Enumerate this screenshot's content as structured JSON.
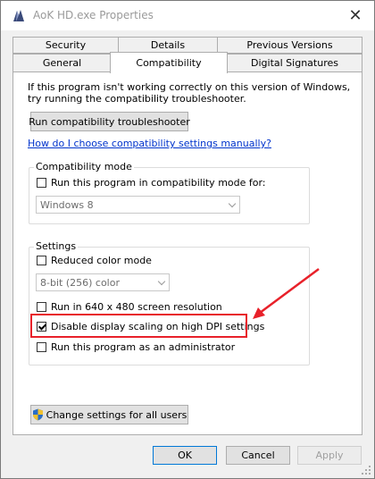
{
  "window": {
    "title": "AoK HD.exe Properties",
    "close_symbol": "✕"
  },
  "tabs": {
    "row1": [
      "Security",
      "Details",
      "Previous Versions"
    ],
    "row2": [
      "General",
      "Compatibility",
      "Digital Signatures"
    ],
    "active": "Compatibility"
  },
  "intro": {
    "line1": "If this program isn't working correctly on this version of Windows,",
    "line2": "try running the compatibility troubleshooter."
  },
  "troubleshooter_button": "Run compatibility troubleshooter",
  "manual_link": "How do I choose compatibility settings manually?",
  "compat_mode": {
    "label": "Compatibility mode",
    "checkbox": {
      "label": "Run this program in compatibility mode for:",
      "checked": false
    },
    "select_value": "Windows 8"
  },
  "settings": {
    "label": "Settings",
    "reduced_color": {
      "label": "Reduced color mode",
      "checked": false
    },
    "color_select_value": "8-bit (256) color",
    "resolution": {
      "label": "Run in 640 x 480 screen resolution",
      "checked": false
    },
    "dpi": {
      "label": "Disable display scaling on high DPI settings",
      "checked": true
    },
    "admin": {
      "label": "Run this program as an administrator",
      "checked": false
    }
  },
  "change_all_button": "Change settings for all users",
  "footer": {
    "ok": "OK",
    "cancel": "Cancel",
    "apply": "Apply"
  },
  "colors": {
    "highlight": "#e8212a",
    "link": "#0033cc",
    "disabled_text": "#a0a0a0"
  }
}
